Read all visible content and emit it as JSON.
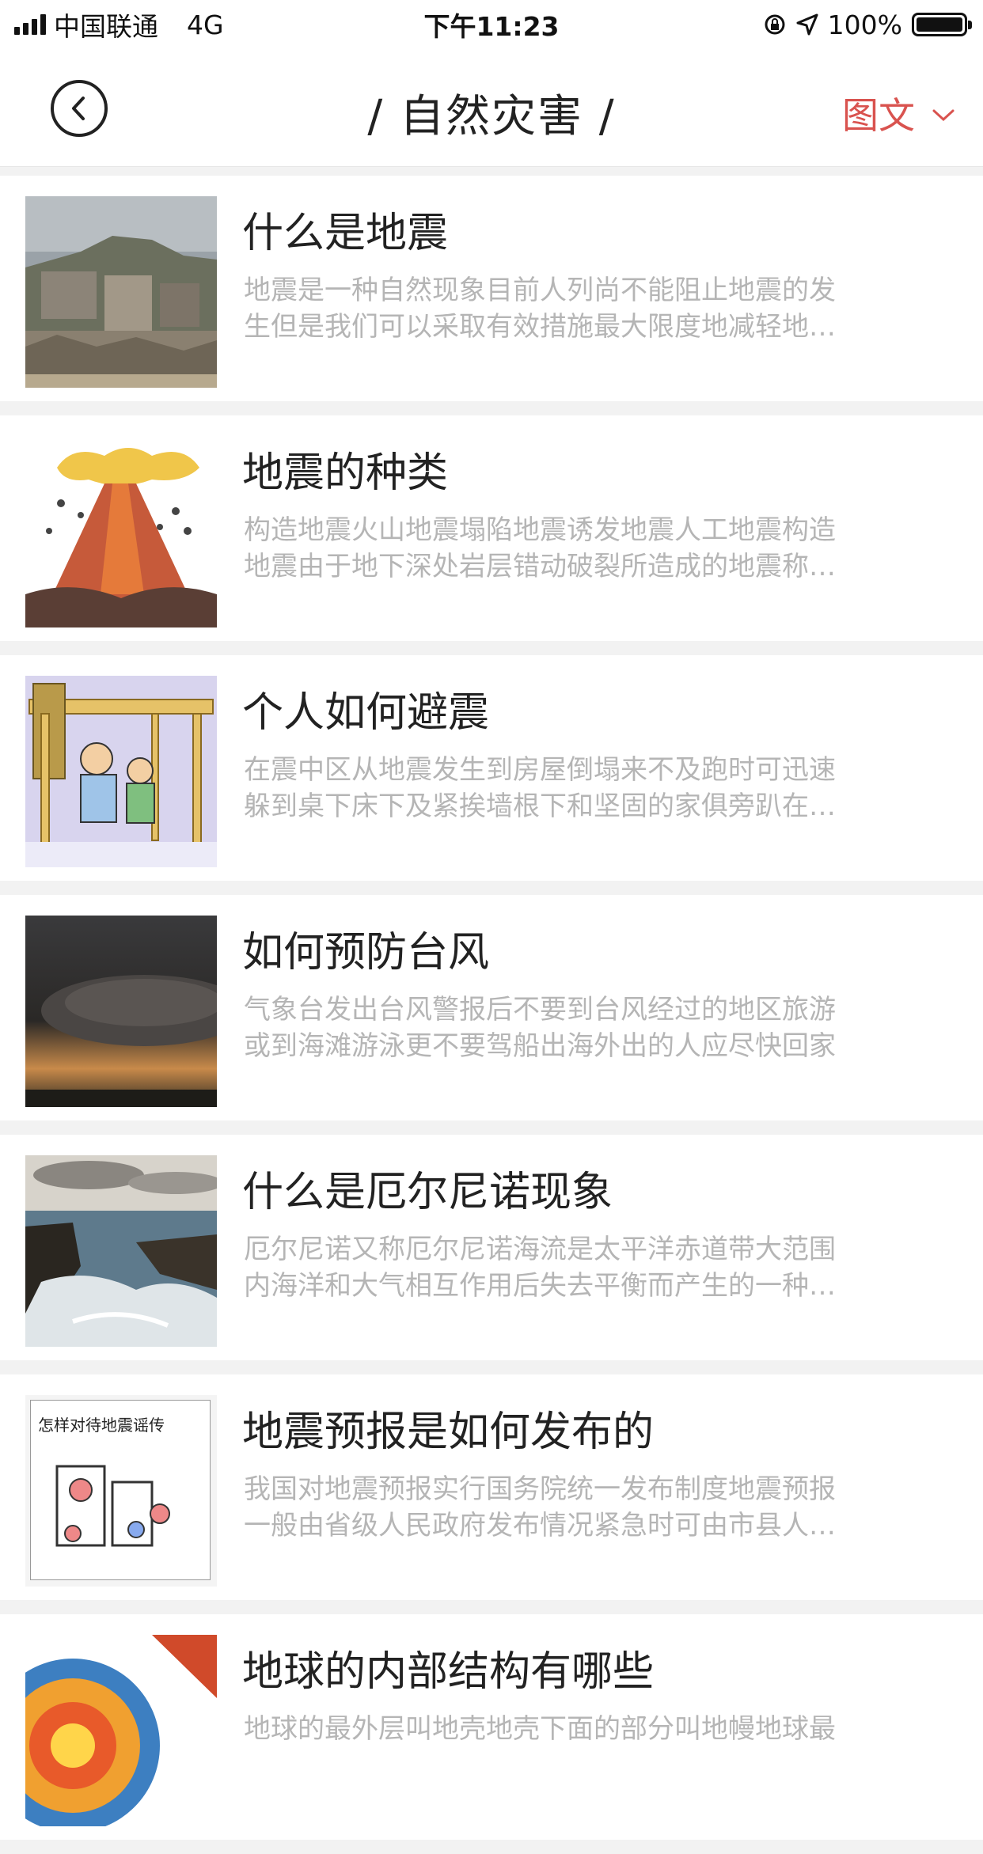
{
  "status": {
    "carrier": "中国联通",
    "network": "4G",
    "time": "下午11:23",
    "battery": "100%"
  },
  "nav": {
    "title": "/ 自然灾害 /",
    "mode": "图文",
    "mode_chevron": "chevron-down-icon",
    "back_icon": "back-arrow-icon"
  },
  "colors": {
    "accent": "#d9534f",
    "summary_text": "#b5b5b5",
    "title_text": "#222222"
  },
  "articles": [
    {
      "title": "什么是地震",
      "line1": "地震是一种自然现象目前人列尚不能阻止地震的发",
      "line2": "生但是我们可以采取有效措施最大限度地减轻地…"
    },
    {
      "title": "地震的种类",
      "line1": "构造地震火山地震塌陷地震诱发地震人工地震构造",
      "line2": "地震由于地下深处岩层错动破裂所造成的地震称…"
    },
    {
      "title": "个人如何避震",
      "line1": "在震中区从地震发生到房屋倒塌来不及跑时可迅速",
      "line2": "躲到桌下床下及紧挨墙根下和坚固的家俱旁趴在…"
    },
    {
      "title": "如何预防台风",
      "line1": "气象台发出台风警报后不要到台风经过的地区旅游",
      "line2": "或到海滩游泳更不要驾船出海外出的人应尽快回家"
    },
    {
      "title": "什么是厄尔尼诺现象",
      "line1": "厄尔尼诺又称厄尔尼诺海流是太平洋赤道带大范围",
      "line2": "内海洋和大气相互作用后失去平衡而产生的一种…"
    },
    {
      "title": "地震预报是如何发布的",
      "line1": "我国对地震预报实行国务院统一发布制度地震预报",
      "line2": "一般由省级人民政府发布情况紧急时可由市县人…",
      "thumb_text": "怎样对待地震谣传"
    },
    {
      "title": "地球的内部结构有哪些",
      "line1": "地球的最外层叫地壳地壳下面的部分叫地幔地球最",
      "line2": ""
    }
  ]
}
